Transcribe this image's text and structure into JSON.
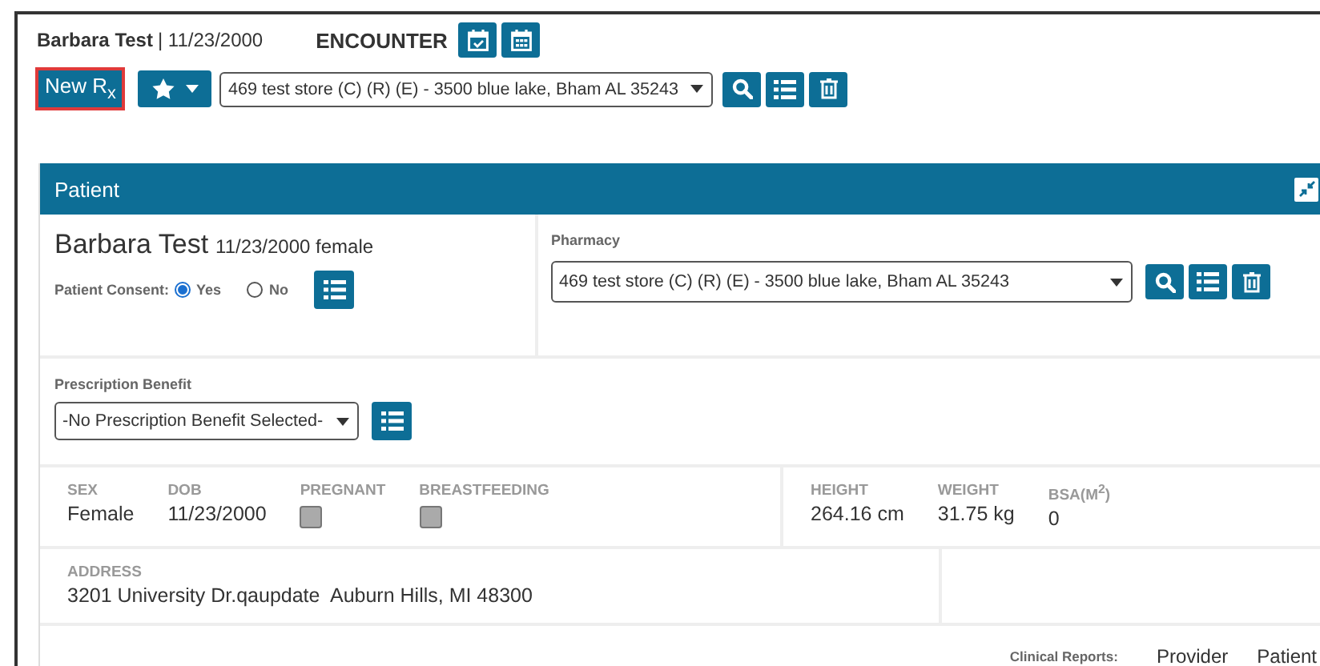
{
  "header": {
    "patient_name": "Barbara Test",
    "dob": "| 11/23/2000",
    "encounter_label": "ENCOUNTER"
  },
  "toolbar": {
    "new_rx": "New R$_{x}$",
    "pharmacy_select": "469 test store (C) (R) (E) - 3500 blue lake, Bham AL 35243"
  },
  "panel": {
    "title": "Patient",
    "patient": {
      "name": "Barbara Test",
      "details": "11/23/2000 female",
      "consent_label": "Patient Consent:",
      "consent_options": [
        {
          "label": "Yes",
          "selected": true
        },
        {
          "label": "No",
          "selected": false
        }
      ]
    },
    "pharmacy": {
      "label": "Pharmacy",
      "value": "469 test store (C) (R) (E) - 3500 blue lake, Bham AL 35243"
    },
    "benefit": {
      "label": "Prescription Benefit",
      "value": "-No Prescription Benefit Selected-"
    },
    "facts": [
      {
        "kind": "text",
        "label": "SEX",
        "value": "Female"
      },
      {
        "kind": "text",
        "label": "DOB",
        "value": "11/23/2000"
      },
      {
        "kind": "checkbox",
        "label": "PREGNANT",
        "checked": false
      },
      {
        "kind": "checkbox",
        "label": "BREASTFEEDING",
        "checked": false
      }
    ],
    "measures": [
      {
        "label": "HEIGHT",
        "value": "264.16 cm"
      },
      {
        "label": "WEIGHT",
        "value": "31.75 kg"
      },
      {
        "label": "BSA(M$^{2}$)",
        "value": "0"
      }
    ],
    "address": {
      "label": "ADDRESS",
      "value": "3201 University Dr.qaupdate  Auburn Hills, MI 48300"
    },
    "clinical_reports": {
      "label": "Clinical Reports:",
      "links": [
        "Provider",
        "Patient"
      ]
    }
  }
}
